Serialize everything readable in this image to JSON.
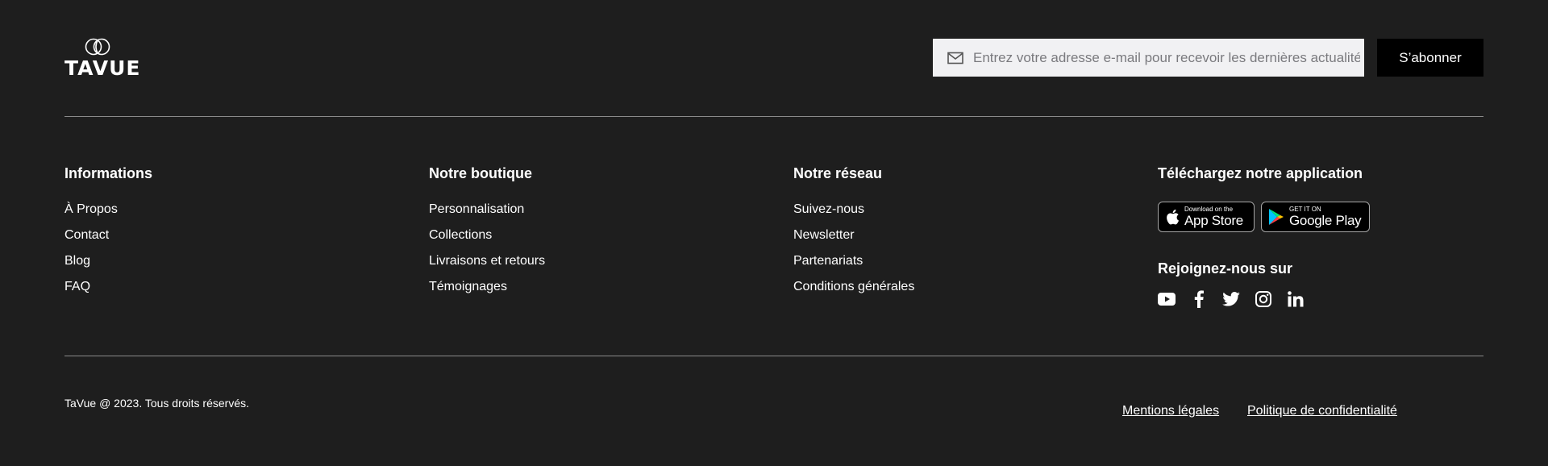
{
  "brand": {
    "logo_text": "TAVUE"
  },
  "newsletter": {
    "placeholder": "Entrez votre adresse e-mail pour recevoir les dernières actualités...",
    "subscribe_label": "S’abonner"
  },
  "columns": [
    {
      "title": "Informations",
      "links": [
        "À Propos",
        "Contact",
        "Blog",
        "FAQ"
      ]
    },
    {
      "title": "Notre boutique",
      "links": [
        "Personnalisation",
        "Collections",
        "Livraisons et retours",
        "Témoignages"
      ]
    },
    {
      "title": "Notre réseau",
      "links": [
        "Suivez-nous",
        "Newsletter",
        "Partenariats",
        "Conditions générales"
      ]
    }
  ],
  "app": {
    "title": "Téléchargez notre application",
    "app_store": {
      "small": "Download on the",
      "big": "App Store"
    },
    "google_play": {
      "small": "GET IT ON",
      "big": "Google Play"
    }
  },
  "social": {
    "title": "Rejoignez-nous sur",
    "icons": [
      "youtube-icon",
      "facebook-icon",
      "twitter-icon",
      "instagram-icon",
      "linkedin-icon"
    ]
  },
  "footer": {
    "copyright": "TaVue @ 2023. Tous droits réservés.",
    "mentions": "Mentions légales",
    "privacy": "Politique de confidentialité"
  }
}
